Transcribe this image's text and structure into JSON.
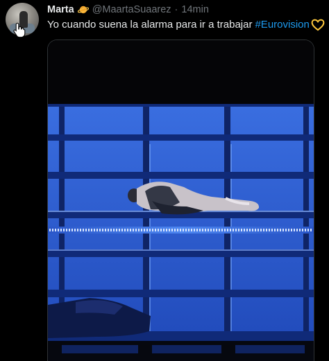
{
  "tweet": {
    "author_name": "Marta",
    "author_badge_icon": "planet-emoji-icon",
    "handle": "@MaartaSuaarez",
    "separator": "·",
    "time": "14min",
    "text": "Yo cuando suena la alarma para ir a trabajar",
    "hashtag": "#Eurovision",
    "trailing_emoji_icon": "yellow-heart-icon",
    "avatar_icon": "user-avatar-photo",
    "media_description_icon": "stage-video-thumbnail"
  },
  "colors": {
    "background": "#000000",
    "text": "#e7e9ea",
    "muted": "#71767b",
    "link": "#1d9bf0",
    "stage_blue": "#2f5fd0"
  }
}
